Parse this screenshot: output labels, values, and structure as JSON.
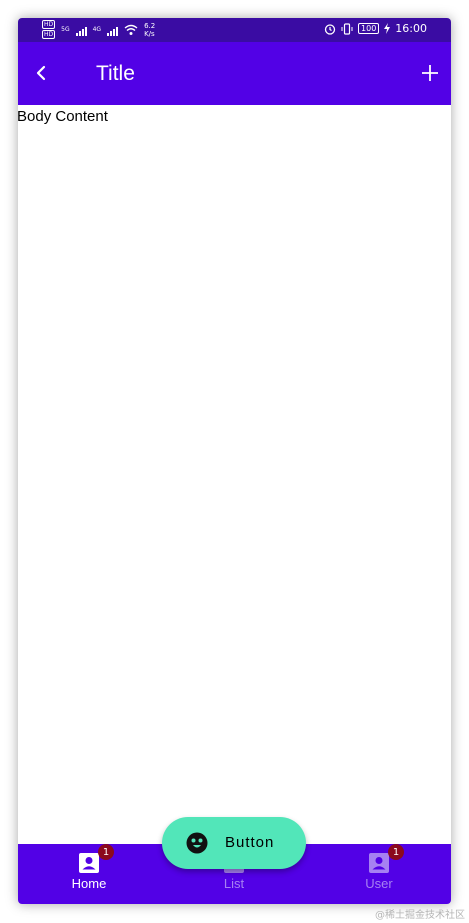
{
  "status_bar": {
    "hd_top": "HD",
    "hd_bottom": "HD",
    "network_1": "5G",
    "network_2": "4G",
    "speed_value": "6.2",
    "speed_unit": "K/s",
    "battery": "100",
    "time": "16:00"
  },
  "app_bar": {
    "title": "Title",
    "back_icon": "chevron-left-icon",
    "action_icon": "add-icon"
  },
  "body": {
    "text": "Body Content"
  },
  "fab": {
    "label": "Button",
    "icon": "face-icon"
  },
  "bottom_nav": {
    "items": [
      {
        "label": "Home",
        "badge": "1",
        "icon": "contact-icon",
        "active": true
      },
      {
        "label": "List",
        "icon": "list-icon",
        "active": false
      },
      {
        "label": "User",
        "badge": "1",
        "icon": "contact-icon",
        "active": false
      }
    ]
  },
  "watermark": "@稀土掘金技术社区",
  "colors": {
    "primary": "#5201e6",
    "status_bar": "#3a0ca3",
    "fab": "#52e6b9",
    "badge": "#8b0a1e"
  }
}
